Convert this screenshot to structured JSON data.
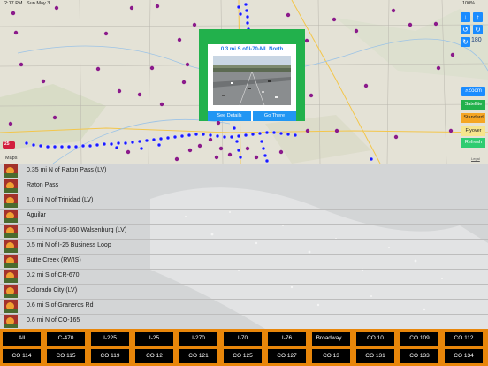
{
  "status_bar": {
    "time": "2:17 PM",
    "date": "Sun May 3",
    "battery": "100%"
  },
  "map": {
    "legal_label": "Legal",
    "attribution": "Maps",
    "interstate_shield": "25",
    "popup": {
      "title": "0.3 mi S of I-70-ML North",
      "see_details": "See Details",
      "go_there": "Go There"
    },
    "controls": {
      "arrow_down": "↓",
      "arrow_up": "↑",
      "rotate_left": "↺",
      "rotate_right": "↻",
      "rotate_value": "180",
      "zoom_label": "Zoom",
      "satellite_label": "Satellite",
      "standard_label": "Standard",
      "flyover_label": "Flyover",
      "refresh_label": "Refresh"
    },
    "colors": {
      "satellite": "#22b14c",
      "standard": "#f5a623",
      "flyover": "#f6e58d",
      "refresh": "#2ecc71",
      "route": "#1a1aff",
      "pin": "#8b1a8b"
    }
  },
  "camera_list": [
    {
      "label": "0.35 mi N of Raton Pass (LV)"
    },
    {
      "label": "Raton Pass"
    },
    {
      "label": "1.0 mi N of Trinidad (LV)"
    },
    {
      "label": "Aguilar"
    },
    {
      "label": "0.5 mi N of US-160 Walsenburg (LV)"
    },
    {
      "label": "0.5 mi N of I-25 Business Loop"
    },
    {
      "label": "Butte Creek (RWIS)"
    },
    {
      "label": "0.2 mi S of CR-670"
    },
    {
      "label": "Colorado City (LV)"
    },
    {
      "label": "0.6 mi S of Graneros Rd"
    },
    {
      "label": "0.6 mi N of CO-165"
    }
  ],
  "route_tabs": {
    "row1": [
      "All",
      "C-470",
      "I-225",
      "I-25",
      "I-270",
      "I-70",
      "I-76",
      "Broadway...",
      "CO 10",
      "CO 109",
      "CO 112"
    ],
    "row2": [
      "CO 114",
      "CO 115",
      "CO 119",
      "CO 12",
      "CO 121",
      "CO 125",
      "CO 127",
      "CO 13",
      "CO 131",
      "CO 133",
      "CO 134"
    ]
  }
}
